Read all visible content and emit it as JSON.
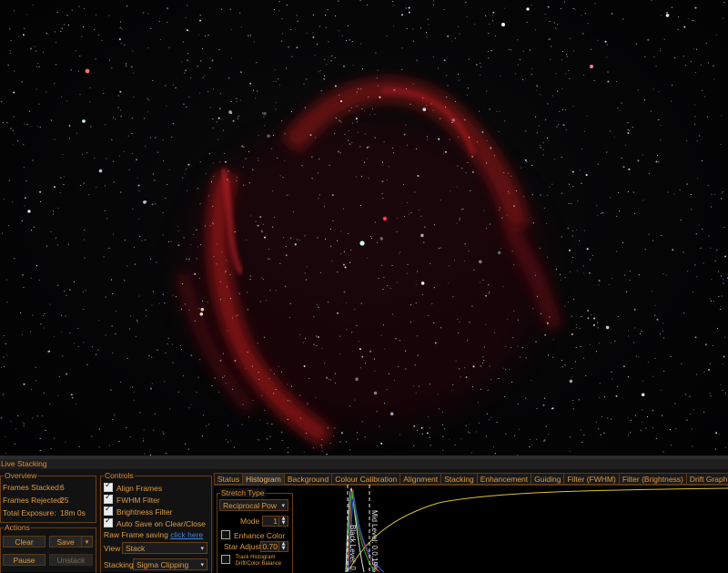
{
  "window": {
    "title": "Live Stacking"
  },
  "overview": {
    "label": "Overview",
    "frames_stacked_label": "Frames Stacked:",
    "frames_stacked": "6",
    "frames_rejected_label": "Frames Rejected:",
    "frames_rejected": "25",
    "total_exposure_label": "Total Exposure:",
    "total_exposure": "18m 0s"
  },
  "actions": {
    "label": "Actions",
    "clear": "Clear",
    "save": "Save",
    "pause": "Pause",
    "unstack": "Unstack"
  },
  "controls": {
    "label": "Controls",
    "align_frames": "Align Frames",
    "fwhm_filter": "FWHM Filter",
    "brightness_filter": "Brightness Filter",
    "auto_save": "Auto Save on Clear/Close",
    "raw_frame_label": "Raw Frame saving",
    "raw_frame_link": "click here",
    "view_label": "View",
    "view_value": "Stack",
    "stacking_label": "Stacking",
    "stacking_value": "Sigma Clipping"
  },
  "tabs": [
    "Status",
    "Histogram",
    "Background",
    "Colour Calibration",
    "Alignment",
    "Stacking",
    "Enhancement",
    "Guiding",
    "Filter (FWHM)",
    "Filter (Brightness)",
    "Drift Graph",
    "Lo"
  ],
  "active_tab": "Histogram",
  "stretch": {
    "label": "Stretch Type",
    "type_value": "Reciprocal Pow",
    "mode_label": "Mode",
    "mode_value": "1",
    "enhance_color": "Enhance Color",
    "star_adjust_label": "Star Adjust",
    "star_adjust_value": "0.70",
    "track_histogram": "Track Histogram",
    "drift_balance": "Drift/Color Balance"
  },
  "histogram": {
    "black_level_label": "Black Level: 0.0",
    "mid_level_label": "Mid Level: 0.0.19%"
  },
  "colors": {
    "accent": "#e08a2c",
    "link": "#3b86e0",
    "nebula": "#b0181e"
  },
  "icons": {
    "dropdown": "chevron-down-icon",
    "spinner": "up-down-icon",
    "checkbox": "check-icon"
  }
}
